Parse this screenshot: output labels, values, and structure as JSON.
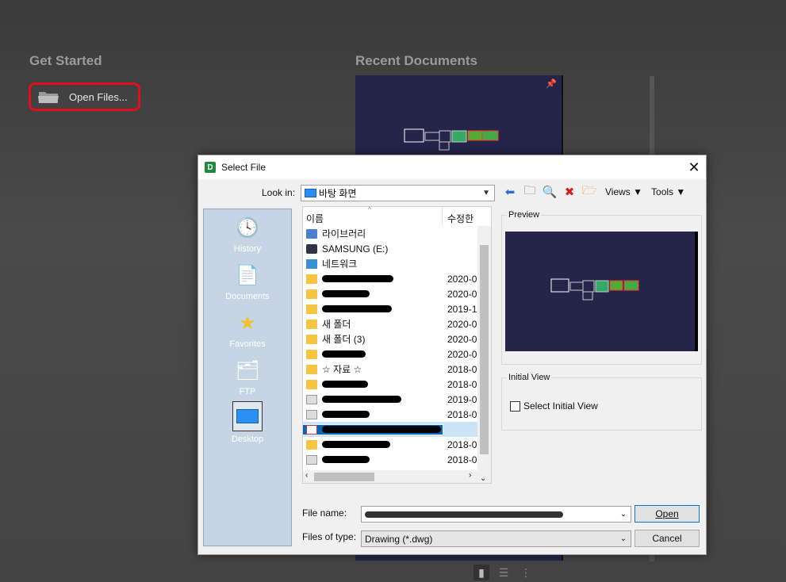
{
  "background": {
    "get_started": "Get Started",
    "open_files": "Open Files...",
    "recent_documents": "Recent Documents"
  },
  "dialog": {
    "title": "Select File",
    "app_icon_letter": "D",
    "look_in_label": "Look in:",
    "look_in_value": "바탕 화면",
    "toolbar": {
      "views": "Views",
      "tools": "Tools"
    },
    "places": [
      {
        "label": "History",
        "icon": "history-icon"
      },
      {
        "label": "Documents",
        "icon": "documents-icon"
      },
      {
        "label": "Favorites",
        "icon": "favorites-icon"
      },
      {
        "label": "FTP",
        "icon": "ftp-icon"
      },
      {
        "label": "Desktop",
        "icon": "desktop-icon"
      }
    ],
    "columns": {
      "name": "이름",
      "modified": "수정한"
    },
    "files": [
      {
        "name": "라이브러리",
        "date": "",
        "icon": "library-folder"
      },
      {
        "name": "SAMSUNG (E:)",
        "date": "",
        "icon": "drive"
      },
      {
        "name": "네트워크",
        "date": "",
        "icon": "network"
      },
      {
        "name": "",
        "date": "2020-0",
        "icon": "folder"
      },
      {
        "name": "",
        "date": "2020-0",
        "icon": "folder"
      },
      {
        "name": "",
        "date": "2019-1",
        "icon": "folder"
      },
      {
        "name": "새 폴더",
        "date": "2020-0",
        "icon": "folder"
      },
      {
        "name": "새 폴더 (3)",
        "date": "2020-0",
        "icon": "folder"
      },
      {
        "name": "",
        "date": "2020-0",
        "icon": "folder"
      },
      {
        "name": "☆ 자료 ☆",
        "date": "2018-0",
        "icon": "shortcut"
      },
      {
        "name": "",
        "date": "2018-0",
        "icon": "shortcut"
      },
      {
        "name": "",
        "date": "2019-0",
        "icon": "shortcut"
      },
      {
        "name": "",
        "date": "2018-0",
        "icon": "shortcut"
      },
      {
        "name": "",
        "date": "",
        "icon": "dwg",
        "selected": true
      },
      {
        "name": "",
        "date": "2018-0",
        "icon": "shortcut"
      },
      {
        "name": "",
        "date": "2018-0",
        "icon": "shortcut"
      }
    ],
    "preview_label": "Preview",
    "initial_view_label": "Initial View",
    "select_initial_view": "Select Initial View",
    "file_name_label": "File name:",
    "file_name_value": "",
    "files_of_type_label": "Files of type:",
    "files_of_type_value": "Drawing (*.dwg)",
    "open_button": "Open",
    "cancel_button": "Cancel"
  },
  "colors": {
    "accent_red": "#e0101a",
    "selection_blue": "#0a64b4",
    "preview_bg": "#25254a"
  }
}
